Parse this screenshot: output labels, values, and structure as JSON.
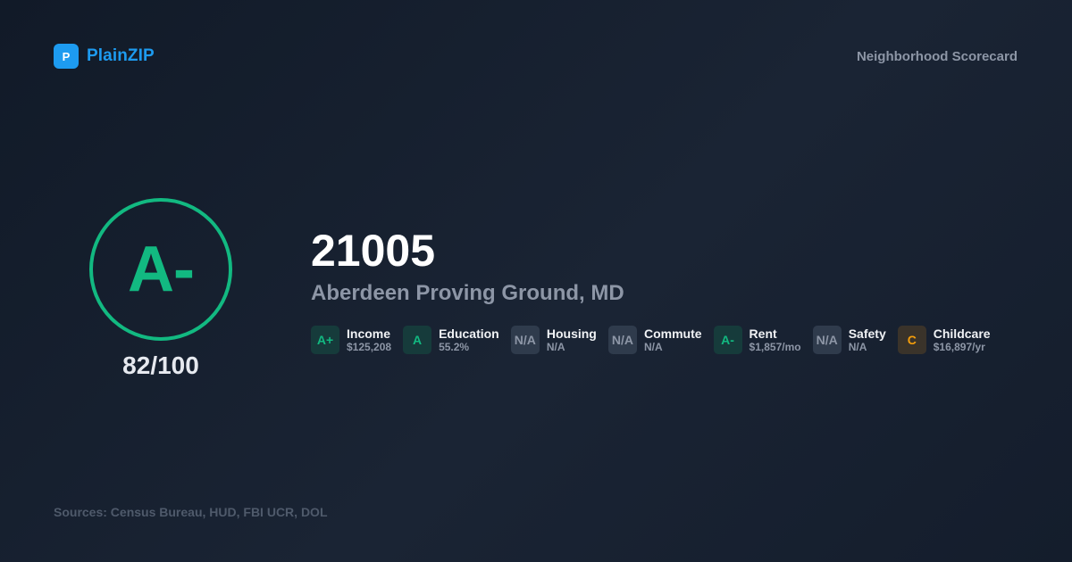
{
  "brand": {
    "logo_letter": "P",
    "name": "PlainZIP"
  },
  "header": {
    "title": "Neighborhood Scorecard"
  },
  "grade": {
    "letter": "A-",
    "score": "82/100"
  },
  "location": {
    "zip": "21005",
    "place": "Aberdeen Proving Ground, MD"
  },
  "metrics": [
    {
      "grade": "A+",
      "label": "Income",
      "value": "$125,208",
      "status": "good"
    },
    {
      "grade": "A",
      "label": "Education",
      "value": "55.2%",
      "status": "good"
    },
    {
      "grade": "N/A",
      "label": "Housing",
      "value": "N/A",
      "status": "na"
    },
    {
      "grade": "N/A",
      "label": "Commute",
      "value": "N/A",
      "status": "na"
    },
    {
      "grade": "A-",
      "label": "Rent",
      "value": "$1,857/mo",
      "status": "good"
    },
    {
      "grade": "N/A",
      "label": "Safety",
      "value": "N/A",
      "status": "na"
    },
    {
      "grade": "C",
      "label": "Childcare",
      "value": "$16,897/yr",
      "status": "warn"
    }
  ],
  "footer": {
    "sources": "Sources: Census Bureau, HUD, FBI UCR, DOL"
  },
  "colors": {
    "brand": "#1d9bf0",
    "good": "#12b981",
    "warn": "#f59e0b",
    "muted": "#8d96a6"
  }
}
